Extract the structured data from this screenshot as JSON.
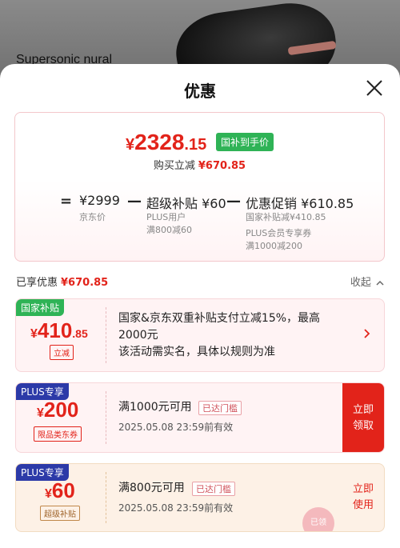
{
  "background": {
    "product_title": "Supersonic nural"
  },
  "sheet": {
    "title": "优惠",
    "close_icon": "close-icon"
  },
  "summary": {
    "final_currency": "¥",
    "final_integer": "2328",
    "final_decimal": ".15",
    "badge": "国补到手价",
    "save_prefix": "购买立减",
    "save_amount": "¥670.85",
    "equals": "=",
    "minus1": "—",
    "minus2": "—",
    "base_price": "¥2999",
    "base_label": "京东价",
    "plus_subsidy_label": "超级补贴",
    "plus_subsidy_value": "¥60",
    "plus_sub1": "PLUS用户",
    "plus_sub2": "满800减60",
    "promo_label": "优惠促销",
    "promo_value": "¥610.85",
    "promo_sub1": "国家补贴减¥410.85",
    "promo_sub2": "PLUS会员专享券",
    "promo_sub3": "满1000减200"
  },
  "savings": {
    "label": "已享优惠",
    "amount": "¥670.85",
    "collapse": "收起",
    "collapse_icon": "chevron-up-icon"
  },
  "coupons": [
    {
      "badge": "国家补贴",
      "currency": "¥",
      "integer": "410",
      "decimal": ".85",
      "tag": "立减",
      "desc_line1": "国家&京东双重补贴支付立减15%，最高",
      "desc_line2": "2000元",
      "desc_line3": "该活动需实名，具体以规则为准",
      "action_icon": "chevron-right-icon"
    },
    {
      "badge": "PLUS专享",
      "currency": "¥",
      "integer": "200",
      "tag": "限品类东券",
      "title": "满1000元可用",
      "threshold": "已达门槛",
      "date": "2025.05.08  23:59前有效",
      "action_line1": "立即",
      "action_line2": "领取"
    },
    {
      "badge": "PLUS专享",
      "currency": "¥",
      "integer": "60",
      "tag": "超级补贴",
      "title": "满800元可用",
      "threshold": "已达门槛",
      "date": "2025.05.08  23:59前有效",
      "action_line1": "立即",
      "action_line2": "使用",
      "stamp": "已领"
    }
  ]
}
